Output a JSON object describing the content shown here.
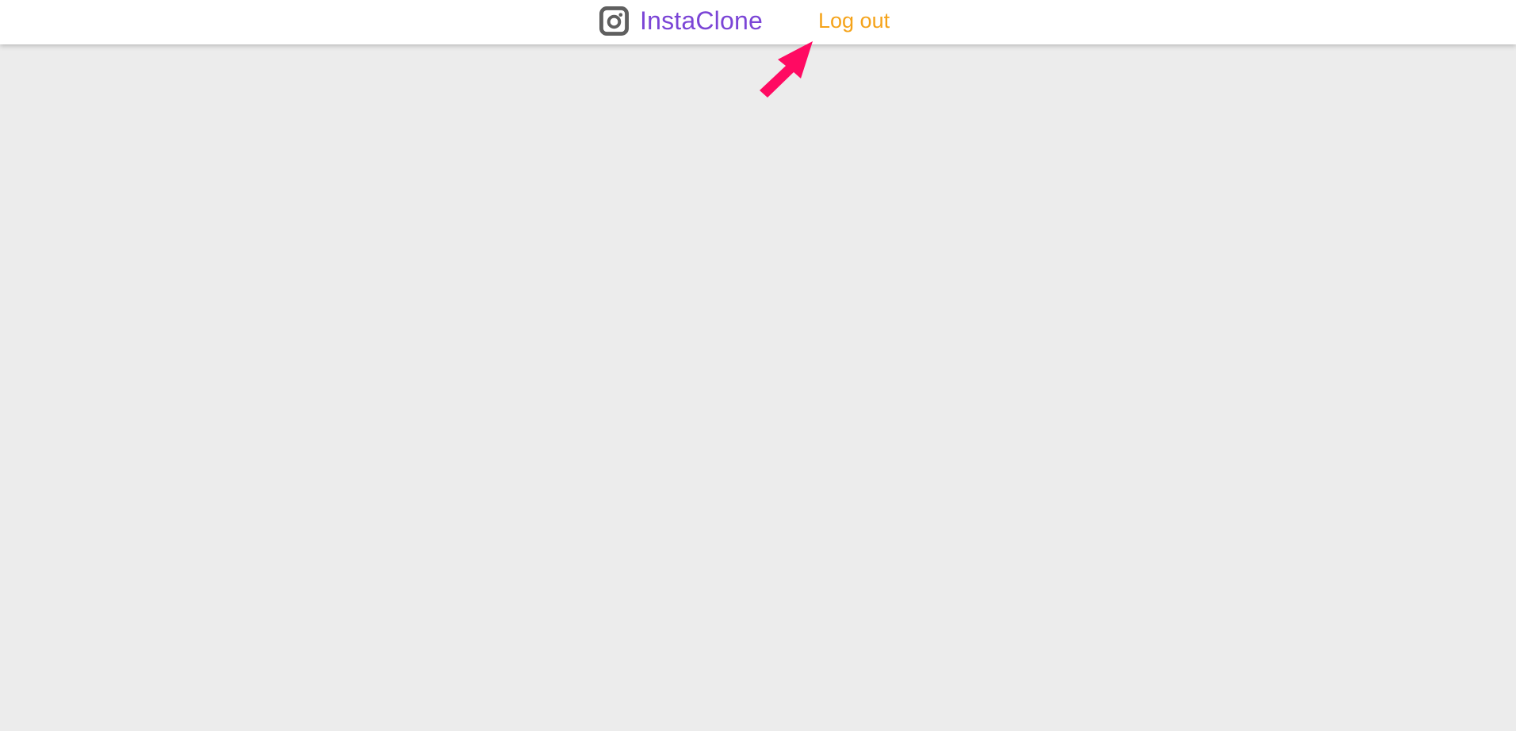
{
  "navbar": {
    "brand_name": "InstaClone",
    "brand_icon": "instagram-icon",
    "logout_label": "Log out"
  },
  "annotation": {
    "icon": "arrow-pointer-icon"
  },
  "colors": {
    "background": "#ececec",
    "navbar_background": "#ffffff",
    "brand_text": "#7b45d6",
    "brand_icon": "#5f5f5f",
    "logout_text": "#f5a31a",
    "arrow": "#ff0a62"
  }
}
